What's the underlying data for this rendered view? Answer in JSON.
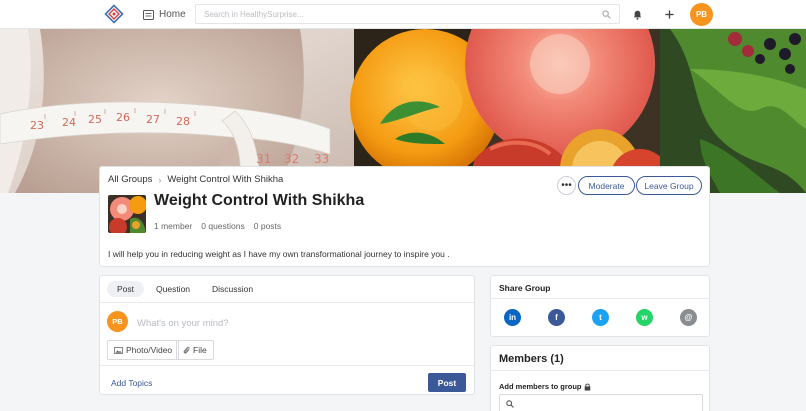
{
  "nav": {
    "home_label": "Home",
    "search_placeholder": "Search in HealthySurprise...",
    "avatar_initials": "PB"
  },
  "group": {
    "breadcrumb_root": "All Groups",
    "breadcrumb_current": "Weight Control With Shikha",
    "title": "Weight Control With Shikha",
    "members_stat": "1 member",
    "questions_stat": "0 questions",
    "posts_stat": "0 posts",
    "description": "I will help you in reducing weight as I have my own transformational journey to inspire you .",
    "more_label": "•••",
    "moderate_label": "Moderate",
    "leave_label": "Leave Group"
  },
  "composer": {
    "tabs": [
      "Post",
      "Question",
      "Discussion"
    ],
    "avatar_initials": "PB",
    "placeholder": "What's on your mind?",
    "photo_label": "Photo/Video",
    "file_label": "File",
    "add_topics_label": "Add Topics",
    "post_label": "Post"
  },
  "share": {
    "title": "Share Group",
    "networks": [
      {
        "name": "linkedin",
        "glyph": "in",
        "color": "#0a66c2"
      },
      {
        "name": "facebook",
        "glyph": "f",
        "color": "#3b5998"
      },
      {
        "name": "twitter",
        "glyph": "t",
        "color": "#1da1f2"
      },
      {
        "name": "whatsapp",
        "glyph": "w",
        "color": "#25d366"
      },
      {
        "name": "email",
        "glyph": "@",
        "color": "#8a8d91"
      }
    ]
  },
  "members": {
    "title": "Members (1)",
    "add_label": "Add members to group"
  },
  "colors": {
    "accent": "#3b5998",
    "avatar": "#f7941d"
  }
}
